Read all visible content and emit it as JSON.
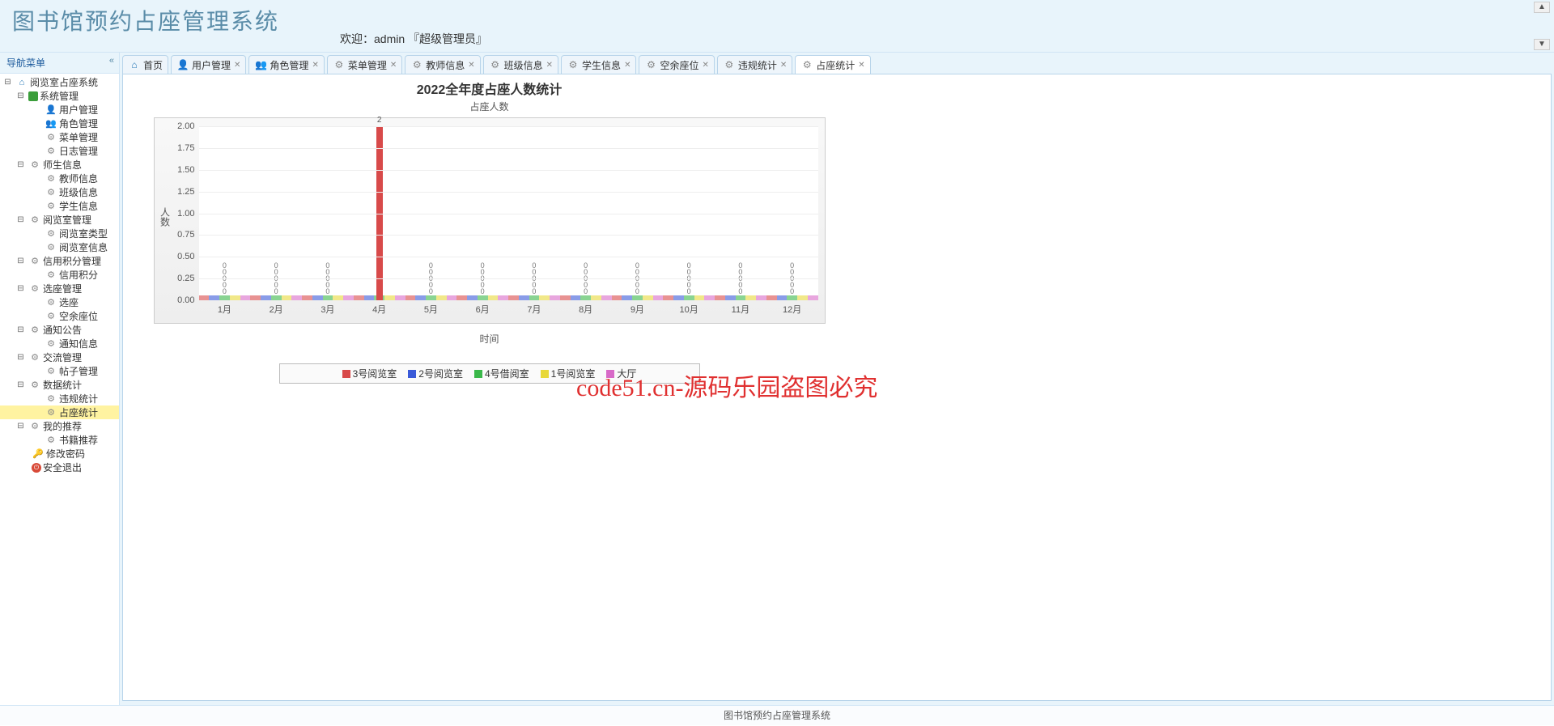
{
  "header": {
    "title": "图书馆预约占座管理系统",
    "welcome": "欢迎：admin 『超级管理员』"
  },
  "sidebar": {
    "title": "导航菜单",
    "root": "阅览室占座系统",
    "groups": [
      {
        "label": "系统管理",
        "items": [
          "用户管理",
          "角色管理",
          "菜单管理",
          "日志管理"
        ]
      },
      {
        "label": "师生信息",
        "items": [
          "教师信息",
          "班级信息",
          "学生信息"
        ]
      },
      {
        "label": "阅览室管理",
        "items": [
          "阅览室类型",
          "阅览室信息"
        ]
      },
      {
        "label": "信用积分管理",
        "items": [
          "信用积分"
        ]
      },
      {
        "label": "选座管理",
        "items": [
          "选座",
          "空余座位"
        ]
      },
      {
        "label": "通知公告",
        "items": [
          "通知信息"
        ]
      },
      {
        "label": "交流管理",
        "items": [
          "帖子管理"
        ]
      },
      {
        "label": "数据统计",
        "items": [
          "违规统计",
          "占座统计"
        ]
      },
      {
        "label": "我的推荐",
        "items": [
          "书籍推荐"
        ]
      }
    ],
    "tail": [
      "修改密码",
      "安全退出"
    ]
  },
  "tabs": [
    {
      "label": "首页",
      "icon": "home",
      "closable": false
    },
    {
      "label": "用户管理",
      "icon": "user",
      "closable": true
    },
    {
      "label": "角色管理",
      "icon": "role",
      "closable": true
    },
    {
      "label": "菜单管理",
      "icon": "gear",
      "closable": true
    },
    {
      "label": "教师信息",
      "icon": "gear",
      "closable": true
    },
    {
      "label": "班级信息",
      "icon": "gear",
      "closable": true
    },
    {
      "label": "学生信息",
      "icon": "gear",
      "closable": true
    },
    {
      "label": "空余座位",
      "icon": "gear",
      "closable": true
    },
    {
      "label": "违规统计",
      "icon": "gear",
      "closable": true
    },
    {
      "label": "占座统计",
      "icon": "gear",
      "closable": true,
      "active": true
    }
  ],
  "chart_data": {
    "type": "bar",
    "title": "2022全年度占座人数统计",
    "subtitle": "占座人数",
    "xlabel": "时间",
    "ylabel": "人数",
    "categories": [
      "1月",
      "2月",
      "3月",
      "4月",
      "5月",
      "6月",
      "7月",
      "8月",
      "9月",
      "10月",
      "11月",
      "12月"
    ],
    "series": [
      {
        "name": "3号阅览室",
        "color": "#d84a4a",
        "values": [
          0,
          0,
          0,
          2,
          0,
          0,
          0,
          0,
          0,
          0,
          0,
          0
        ]
      },
      {
        "name": "2号阅览室",
        "color": "#3a5ad8",
        "values": [
          0,
          0,
          0,
          0,
          0,
          0,
          0,
          0,
          0,
          0,
          0,
          0
        ]
      },
      {
        "name": "4号借阅室",
        "color": "#3ab84a",
        "values": [
          0,
          0,
          0,
          0,
          0,
          0,
          0,
          0,
          0,
          0,
          0,
          0
        ]
      },
      {
        "name": "1号阅览室",
        "color": "#e8d83a",
        "values": [
          0,
          0,
          0,
          0,
          0,
          0,
          0,
          0,
          0,
          0,
          0,
          0
        ]
      },
      {
        "name": "大厅",
        "color": "#d86ac8",
        "values": [
          0,
          0,
          0,
          0,
          0,
          0,
          0,
          0,
          0,
          0,
          0,
          0
        ]
      }
    ],
    "ylim": [
      0,
      2
    ],
    "yticks": [
      0.0,
      0.25,
      0.5,
      0.75,
      1.0,
      1.25,
      1.5,
      1.75,
      2.0
    ],
    "bar_label": "2",
    "zero_label": "0"
  },
  "watermark": "code51.cn-源码乐园盗图必究",
  "footer": "图书馆预约占座管理系统"
}
